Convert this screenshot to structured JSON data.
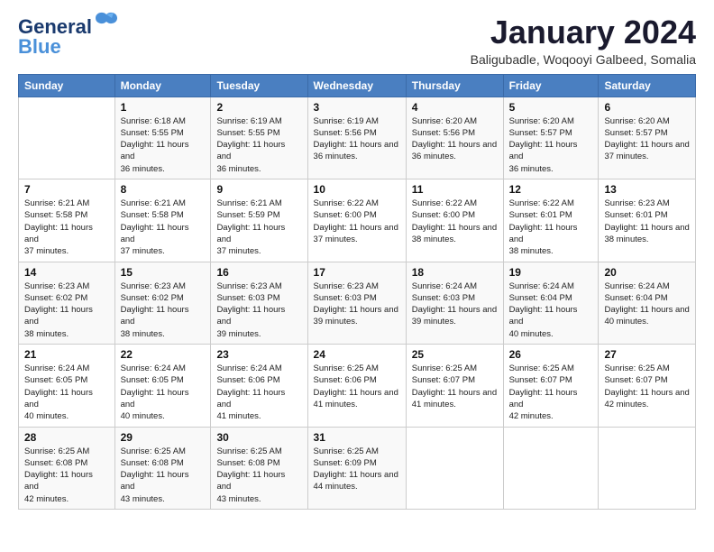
{
  "logo": {
    "line1": "General",
    "line2": "Blue"
  },
  "title": "January 2024",
  "location": "Baligubadle, Woqooyi Galbeed, Somalia",
  "days_of_week": [
    "Sunday",
    "Monday",
    "Tuesday",
    "Wednesday",
    "Thursday",
    "Friday",
    "Saturday"
  ],
  "weeks": [
    [
      null,
      {
        "num": "1",
        "rise": "6:18 AM",
        "set": "5:55 PM",
        "daylight": "11 hours and 36 minutes."
      },
      {
        "num": "2",
        "rise": "6:19 AM",
        "set": "5:55 PM",
        "daylight": "11 hours and 36 minutes."
      },
      {
        "num": "3",
        "rise": "6:19 AM",
        "set": "5:56 PM",
        "daylight": "11 hours and 36 minutes."
      },
      {
        "num": "4",
        "rise": "6:20 AM",
        "set": "5:56 PM",
        "daylight": "11 hours and 36 minutes."
      },
      {
        "num": "5",
        "rise": "6:20 AM",
        "set": "5:57 PM",
        "daylight": "11 hours and 36 minutes."
      },
      {
        "num": "6",
        "rise": "6:20 AM",
        "set": "5:57 PM",
        "daylight": "11 hours and 37 minutes."
      }
    ],
    [
      {
        "num": "7",
        "rise": "6:21 AM",
        "set": "5:58 PM",
        "daylight": "11 hours and 37 minutes."
      },
      {
        "num": "8",
        "rise": "6:21 AM",
        "set": "5:58 PM",
        "daylight": "11 hours and 37 minutes."
      },
      {
        "num": "9",
        "rise": "6:21 AM",
        "set": "5:59 PM",
        "daylight": "11 hours and 37 minutes."
      },
      {
        "num": "10",
        "rise": "6:22 AM",
        "set": "6:00 PM",
        "daylight": "11 hours and 37 minutes."
      },
      {
        "num": "11",
        "rise": "6:22 AM",
        "set": "6:00 PM",
        "daylight": "11 hours and 38 minutes."
      },
      {
        "num": "12",
        "rise": "6:22 AM",
        "set": "6:01 PM",
        "daylight": "11 hours and 38 minutes."
      },
      {
        "num": "13",
        "rise": "6:23 AM",
        "set": "6:01 PM",
        "daylight": "11 hours and 38 minutes."
      }
    ],
    [
      {
        "num": "14",
        "rise": "6:23 AM",
        "set": "6:02 PM",
        "daylight": "11 hours and 38 minutes."
      },
      {
        "num": "15",
        "rise": "6:23 AM",
        "set": "6:02 PM",
        "daylight": "11 hours and 38 minutes."
      },
      {
        "num": "16",
        "rise": "6:23 AM",
        "set": "6:03 PM",
        "daylight": "11 hours and 39 minutes."
      },
      {
        "num": "17",
        "rise": "6:23 AM",
        "set": "6:03 PM",
        "daylight": "11 hours and 39 minutes."
      },
      {
        "num": "18",
        "rise": "6:24 AM",
        "set": "6:03 PM",
        "daylight": "11 hours and 39 minutes."
      },
      {
        "num": "19",
        "rise": "6:24 AM",
        "set": "6:04 PM",
        "daylight": "11 hours and 40 minutes."
      },
      {
        "num": "20",
        "rise": "6:24 AM",
        "set": "6:04 PM",
        "daylight": "11 hours and 40 minutes."
      }
    ],
    [
      {
        "num": "21",
        "rise": "6:24 AM",
        "set": "6:05 PM",
        "daylight": "11 hours and 40 minutes."
      },
      {
        "num": "22",
        "rise": "6:24 AM",
        "set": "6:05 PM",
        "daylight": "11 hours and 40 minutes."
      },
      {
        "num": "23",
        "rise": "6:24 AM",
        "set": "6:06 PM",
        "daylight": "11 hours and 41 minutes."
      },
      {
        "num": "24",
        "rise": "6:25 AM",
        "set": "6:06 PM",
        "daylight": "11 hours and 41 minutes."
      },
      {
        "num": "25",
        "rise": "6:25 AM",
        "set": "6:07 PM",
        "daylight": "11 hours and 41 minutes."
      },
      {
        "num": "26",
        "rise": "6:25 AM",
        "set": "6:07 PM",
        "daylight": "11 hours and 42 minutes."
      },
      {
        "num": "27",
        "rise": "6:25 AM",
        "set": "6:07 PM",
        "daylight": "11 hours and 42 minutes."
      }
    ],
    [
      {
        "num": "28",
        "rise": "6:25 AM",
        "set": "6:08 PM",
        "daylight": "11 hours and 42 minutes."
      },
      {
        "num": "29",
        "rise": "6:25 AM",
        "set": "6:08 PM",
        "daylight": "11 hours and 43 minutes."
      },
      {
        "num": "30",
        "rise": "6:25 AM",
        "set": "6:08 PM",
        "daylight": "11 hours and 43 minutes."
      },
      {
        "num": "31",
        "rise": "6:25 AM",
        "set": "6:09 PM",
        "daylight": "11 hours and 44 minutes."
      },
      null,
      null,
      null
    ]
  ]
}
